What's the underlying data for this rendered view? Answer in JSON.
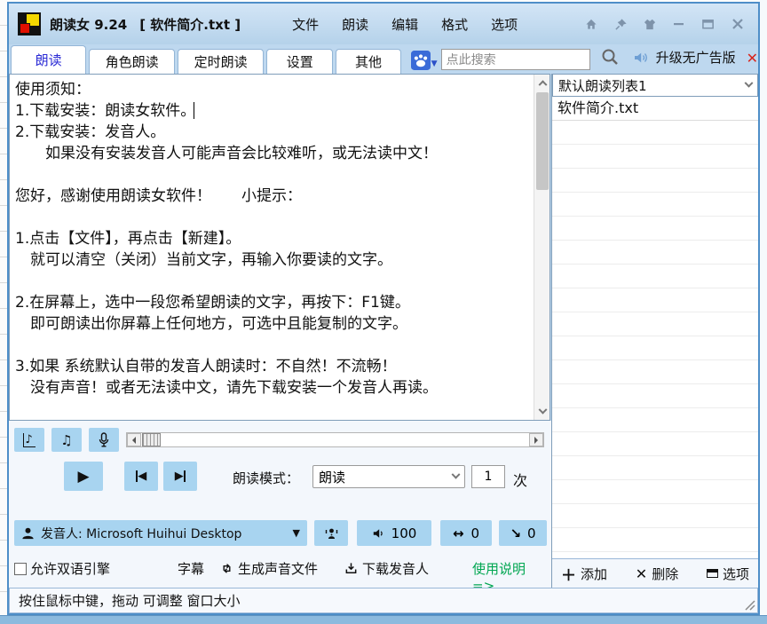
{
  "window": {
    "title": "朗读女 9.24",
    "document": "[ 软件简介.txt ]",
    "menu": [
      "文件",
      "朗读",
      "编辑",
      "格式",
      "选项"
    ]
  },
  "tabs": {
    "labels": [
      "朗读",
      "角色朗读",
      "定时朗读",
      "设置",
      "其他"
    ],
    "active": "朗读"
  },
  "toolbar": {
    "search_placeholder": "点此搜索",
    "upgrade_label": "升级无广告版"
  },
  "editor": {
    "text": "使用须知：\n1.下载安装：朗读女软件。\n2.下载安装：发音人。\n　　如果没有安装发音人可能声音会比较难听，或无法读中文！\n\n您好，感谢使用朗读女软件！　　小提示：\n\n1.点击【文件】，再点击【新建】。\n　就可以清空（关闭）当前文字，再输入你要读的文字。\n\n2.在屏幕上，选中一段您希望朗读的文字，再按下：F1键。\n　即可朗读出你屏幕上任何地方，可选中且能复制的文字。\n\n3.如果 系统默认自带的发音人朗读时：不自然！不流畅！\n　没有声音！或者无法读中文，请先下载安装一个发音人再读。"
  },
  "playlist": {
    "list_name": "默认朗读列表1",
    "items": [
      "软件简介.txt"
    ],
    "add_label": "添加",
    "delete_label": "删除",
    "options_label": "选项"
  },
  "controls": {
    "mode_label": "朗读模式：",
    "mode_value": "朗读",
    "repeat_count": "1",
    "repeat_unit": "次",
    "voice_label": "发音人: Microsoft Huihui Desktop",
    "volume": "100",
    "rate": "0",
    "pitch": "0",
    "bilingual_label": "允许双语引擎",
    "subtitle_label": "字幕",
    "generate_audio_label": "生成声音文件",
    "download_voice_label": "下载发音人",
    "help_label": "使用说明 =>"
  },
  "status": {
    "text": "按住鼠标中键，拖动 可调整 窗口大小"
  },
  "colors": {
    "titlebar_blue": "#bed8ef",
    "button_blue": "#a8d4f0",
    "active_tab_text": "#2b2bd5",
    "close_red": "#d9251c",
    "help_green": "#00a651"
  }
}
